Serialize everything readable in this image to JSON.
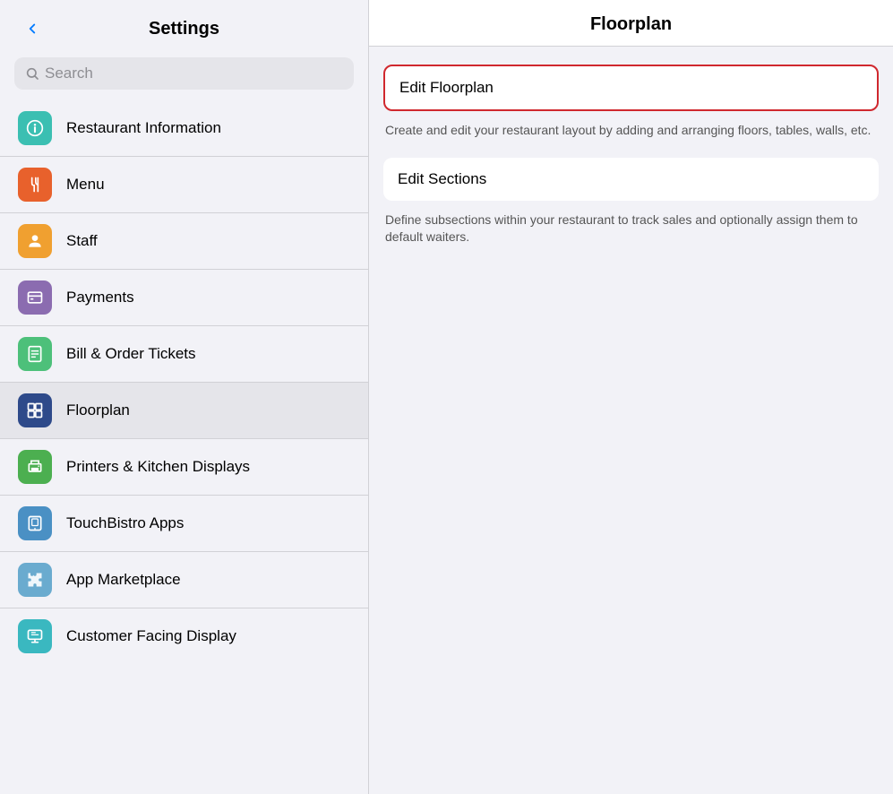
{
  "header": {
    "back_label": "‹",
    "title": "Settings"
  },
  "search": {
    "placeholder": "Search"
  },
  "menu_items": [
    {
      "id": "restaurant-information",
      "label": "Restaurant Information",
      "icon_class": "icon-teal",
      "icon": "ℹ"
    },
    {
      "id": "menu",
      "label": "Menu",
      "icon_class": "icon-orange",
      "icon": "🍴"
    },
    {
      "id": "staff",
      "label": "Staff",
      "icon_class": "icon-amber",
      "icon": "👤"
    },
    {
      "id": "payments",
      "label": "Payments",
      "icon_class": "icon-purple",
      "icon": "▦"
    },
    {
      "id": "bill-order-tickets",
      "label": "Bill & Order Tickets",
      "icon_class": "icon-green",
      "icon": "▤"
    },
    {
      "id": "floorplan",
      "label": "Floorplan",
      "icon_class": "icon-navy",
      "icon": "▦",
      "active": true
    },
    {
      "id": "printers-kitchen",
      "label": "Printers & Kitchen Displays",
      "icon_class": "icon-bright-green",
      "icon": "▨"
    },
    {
      "id": "touchbistro-apps",
      "label": "TouchBistro Apps",
      "icon_class": "icon-blue",
      "icon": "▢"
    },
    {
      "id": "app-marketplace",
      "label": "App Marketplace",
      "icon_class": "icon-puzzle",
      "icon": "✦"
    },
    {
      "id": "customer-facing",
      "label": "Customer Facing Display",
      "icon_class": "icon-cyan",
      "icon": "▦"
    }
  ],
  "right_panel": {
    "title": "Floorplan",
    "options": [
      {
        "id": "edit-floorplan",
        "label": "Edit Floorplan",
        "description": "Create and edit your restaurant layout by adding and arranging floors, tables, walls, etc.",
        "highlighted": true
      },
      {
        "id": "edit-sections",
        "label": "Edit Sections",
        "description": "Define subsections within your restaurant to track sales and optionally assign them to default waiters.",
        "highlighted": false
      }
    ]
  }
}
